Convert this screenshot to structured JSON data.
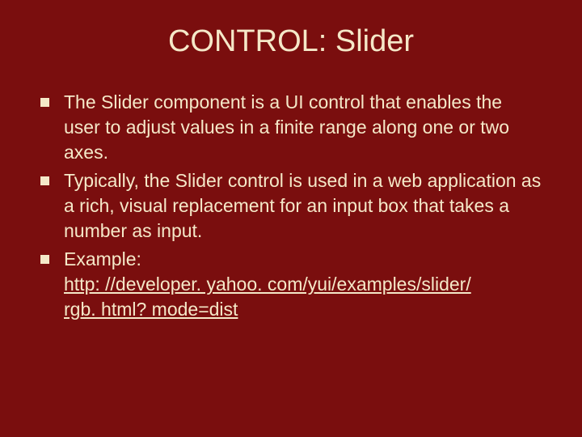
{
  "slide": {
    "title": "CONTROL: Slider",
    "bullets": [
      {
        "text": "The Slider component is a UI control that enables the user to adjust values in a finite range along one or two axes."
      },
      {
        "text": "Typically, the Slider control is used in a web application as a rich, visual replacement for an input box that takes a number as input."
      },
      {
        "label": "Example:",
        "link1": "http: //developer. yahoo. com/yui/examples/slider/",
        "link2": "rgb. html? mode=dist"
      }
    ]
  }
}
